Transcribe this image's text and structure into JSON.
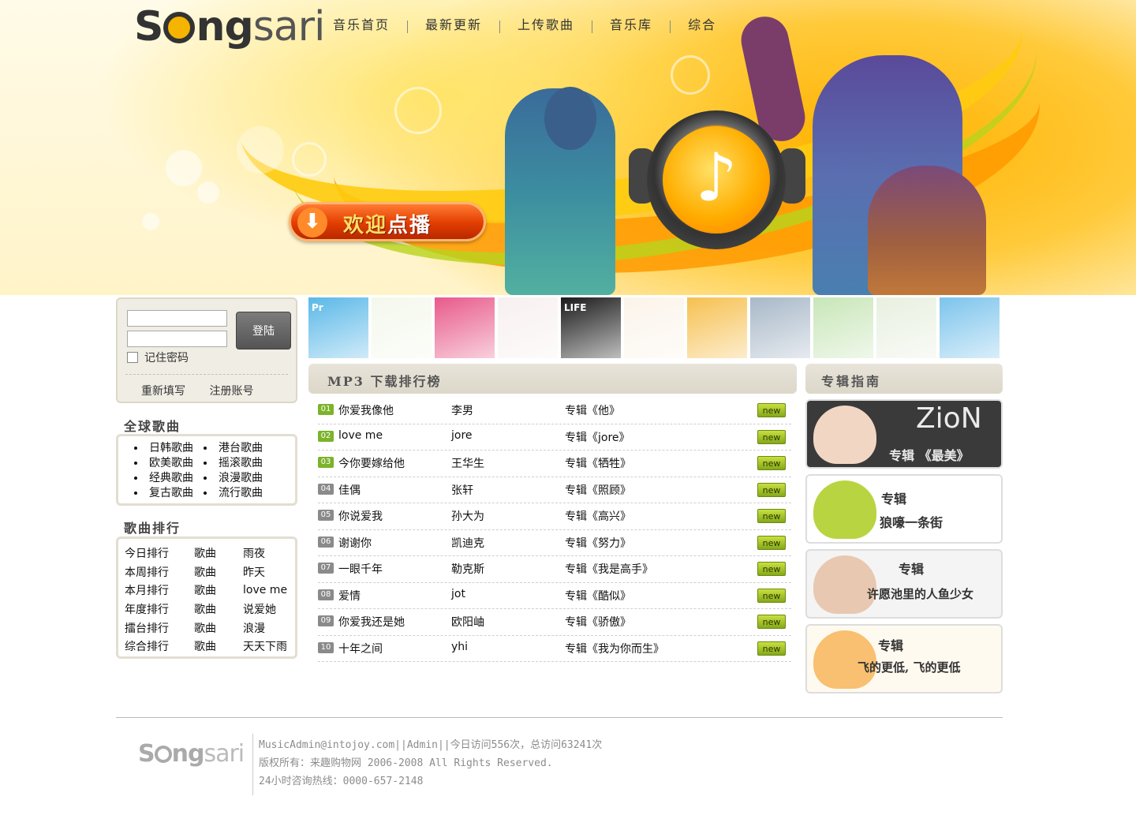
{
  "brand": {
    "logo_pre": "S",
    "logo_mid": "ng",
    "logo_post": "sari"
  },
  "nav": [
    "音乐首页",
    "最新更新",
    "上传歌曲",
    "音乐库",
    "综合"
  ],
  "banner": {
    "welcome_a": "欢迎",
    "welcome_b": "点播",
    "download_glyph": "⬇",
    "note_glyph": "♪"
  },
  "login": {
    "button": "登陆",
    "remember": "记住密码",
    "reset": "重新填写",
    "register": "注册账号",
    "user_value": "",
    "pass_value": ""
  },
  "global_songs": {
    "title": "全球歌曲",
    "items": [
      "日韩歌曲",
      "港台歌曲",
      "欧美歌曲",
      "摇滚歌曲",
      "经典歌曲",
      "浪漫歌曲",
      "复古歌曲",
      "流行歌曲"
    ]
  },
  "song_rank": {
    "title": "歌曲排行",
    "rows": [
      [
        "今日排行",
        "歌曲",
        "雨夜"
      ],
      [
        "本周排行",
        "歌曲",
        "昨天"
      ],
      [
        "本月排行",
        "歌曲",
        "love me"
      ],
      [
        "年度排行",
        "歌曲",
        "说爱她"
      ],
      [
        "擂台排行",
        "歌曲",
        "浪漫"
      ],
      [
        "综合排行",
        "歌曲",
        "天天下雨"
      ]
    ]
  },
  "thumbs": [
    {
      "color": "#5ab8e8",
      "label": "Pr"
    },
    {
      "color": "#f4f8ec",
      "label": ""
    },
    {
      "color": "#e85a8a",
      "label": ""
    },
    {
      "color": "#f8f0f0",
      "label": ""
    },
    {
      "color": "#1a1a1a",
      "label": "LIFE"
    },
    {
      "color": "#fbf4ea",
      "label": ""
    },
    {
      "color": "#f6c050",
      "label": ""
    },
    {
      "color": "#a8b8c8",
      "label": ""
    },
    {
      "color": "#c8e6b8",
      "label": ""
    },
    {
      "color": "#e8f0e0",
      "label": ""
    },
    {
      "color": "#7cc4ec",
      "label": ""
    }
  ],
  "chart": {
    "title": "MP3 下载排行榜",
    "new_label": "new",
    "songs": [
      {
        "num": "01",
        "name": "你爱我像他",
        "artist": "李男",
        "album": "专辑《他》"
      },
      {
        "num": "02",
        "name": "love me",
        "artist": "jore",
        "album": "专辑《jore》"
      },
      {
        "num": "03",
        "name": "今你要嫁给他",
        "artist": "王华生",
        "album": "专辑《牺牲》"
      },
      {
        "num": "04",
        "name": "佳偶",
        "artist": "张轩",
        "album": "专辑《照顾》"
      },
      {
        "num": "05",
        "name": "你说爱我",
        "artist": "孙大为",
        "album": "专辑《高兴》"
      },
      {
        "num": "06",
        "name": "谢谢你",
        "artist": "凯迪克",
        "album": "专辑《努力》"
      },
      {
        "num": "07",
        "name": "一眼千年",
        "artist": "勒克斯",
        "album": "专辑《我是高手》"
      },
      {
        "num": "08",
        "name": "爱情",
        "artist": "jot",
        "album": "专辑《酷似》"
      },
      {
        "num": "09",
        "name": "你爱我还是她",
        "artist": "欧阳岫",
        "album": "专辑《骄傲》"
      },
      {
        "num": "10",
        "name": "十年之间",
        "artist": "yhi",
        "album": "专辑《我为你而生》"
      }
    ],
    "num_colors": {
      "top": "#7bb32a",
      "rest": "#8a8a8a"
    }
  },
  "albums": {
    "title": "专辑指南",
    "cards": [
      {
        "line1": "ZioN",
        "line2": "专辑 《最美》",
        "bg": "#3a3a3a",
        "fg": "#eaeaea",
        "face": "#f2d6c4"
      },
      {
        "line1": "专辑",
        "line2": "狼嚎一条街",
        "bg": "#ffffff",
        "fg": "#333333",
        "face": "#b8d440"
      },
      {
        "line1": "专辑",
        "line2": "许愿池里的人鱼少女",
        "bg": "#f4f4f4",
        "fg": "#333333",
        "face": "#e8c8b0"
      },
      {
        "line1": "专辑",
        "line2": "飞的更低, 飞的更低",
        "bg": "#fffaf0",
        "fg": "#333333",
        "face": "#f8c070"
      }
    ]
  },
  "footer": {
    "line1": "MusicAdmin@intojoy.com||Admin||今日访问556次，总访问63241次",
    "line2": "版权所有：来趣购物网 2006-2008 All Rights Reserved.",
    "line3": "24小时咨询热线：0000-657-2148"
  }
}
